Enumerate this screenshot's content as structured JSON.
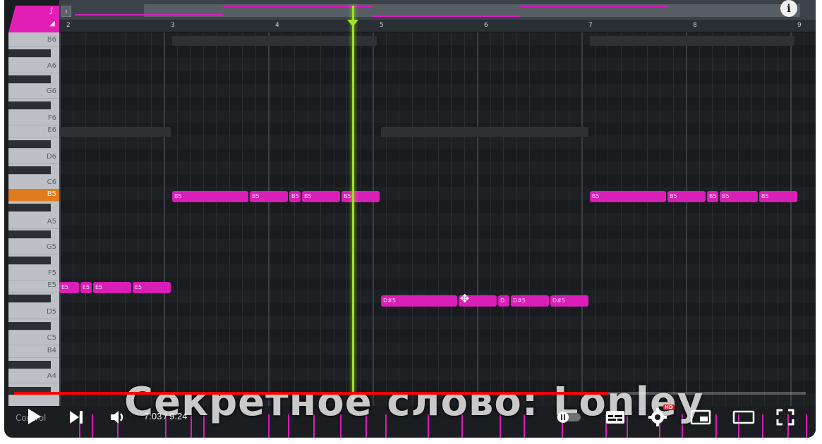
{
  "ruler": [
    "2",
    "3",
    "4",
    "5",
    "6",
    "7",
    "8",
    "9"
  ],
  "keys": [
    {
      "label": "B6",
      "black": false
    },
    {
      "label": "A6",
      "black": false
    },
    {
      "label": "G6",
      "black": false
    },
    {
      "label": "F6",
      "black": false
    },
    {
      "label": "E6",
      "black": false
    },
    {
      "label": "D6",
      "black": false
    },
    {
      "label": "C6",
      "black": false
    },
    {
      "label": "B5",
      "black": false,
      "active": true
    },
    {
      "label": "A5",
      "black": false
    },
    {
      "label": "G5",
      "black": false
    },
    {
      "label": "F5",
      "black": false
    },
    {
      "label": "E5",
      "black": false
    },
    {
      "label": "D5",
      "black": false
    },
    {
      "label": "C5",
      "black": false
    },
    {
      "label": "B4",
      "black": false
    },
    {
      "label": "A4",
      "black": false
    }
  ],
  "notes_b5": [
    "B5",
    "B5",
    "B5",
    "B5",
    "B5",
    "B5",
    "B5",
    "B5",
    "B5",
    "B5"
  ],
  "notes_e5": [
    "E5",
    "E5",
    "E5",
    "E5"
  ],
  "notes_ds5": [
    "D#5",
    "",
    "D.",
    "D#5",
    "D#5"
  ],
  "subtitle": "Секретное слово: Lonley",
  "controls": {
    "time": "7:03 / 9:24",
    "control_label": "Control",
    "hd_badge": "HD",
    "progress": 0.75
  },
  "colors": {
    "note": "#d91fb8",
    "playhead": "#9be21f",
    "progress": "#ff0000"
  }
}
